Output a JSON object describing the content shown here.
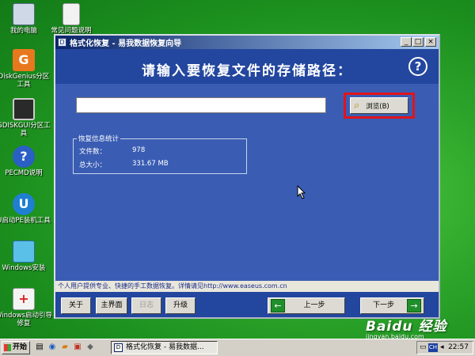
{
  "desktop": {
    "icons": [
      {
        "label": "我的电脑"
      },
      {
        "label": "常见问题说明"
      },
      {
        "label": "DiskGenius分区工具",
        "badge": "G"
      },
      {
        "label": "GDISKGUI分区工具"
      },
      {
        "label": "PECMD说明",
        "badge": "?"
      },
      {
        "label": "U启动PE装机工具",
        "badge": "U"
      },
      {
        "label": "Windows安装"
      },
      {
        "label": "Windows启动引导修复"
      }
    ]
  },
  "window": {
    "title": "格式化恢复 - 易我数据恢复向导",
    "title_icon": "D",
    "controls": {
      "minimize": "_",
      "maximize": "□",
      "close": "×"
    },
    "header_text": "请输入要恢复文件的存储路径：",
    "help_icon": "?",
    "path_input": {
      "value": "",
      "placeholder": ""
    },
    "browse_label": "浏览(B)",
    "stats": {
      "legend": "恢复信息统计",
      "rows": [
        {
          "label": "文件数：",
          "value": "978"
        },
        {
          "label": "总大小：",
          "value": "331.67 MB"
        }
      ]
    },
    "footer_info": "个人用户提供专业、快捷的手工数据恢复。详情请见http://www.easeus.com.cn",
    "buttons": {
      "about": "关于",
      "main": "主界面",
      "log": "日志",
      "upgrade": "升级",
      "prev": "上一步",
      "next": "下一步"
    },
    "arrows": {
      "prev": "←",
      "next": "→"
    }
  },
  "taskbar": {
    "start": "开始",
    "task_icon": "D",
    "task_label": "格式化恢复 - 易我数据...",
    "tray_lang": "CH",
    "clock": "22:57"
  },
  "watermark": {
    "brand": "Baidu 经验",
    "url": "jingyan.baidu.com"
  },
  "colors": {
    "window_bg": "#3a5db3",
    "header_bg": "#23479e",
    "highlight": "#e0141c",
    "desktop": "#2fa82c"
  }
}
